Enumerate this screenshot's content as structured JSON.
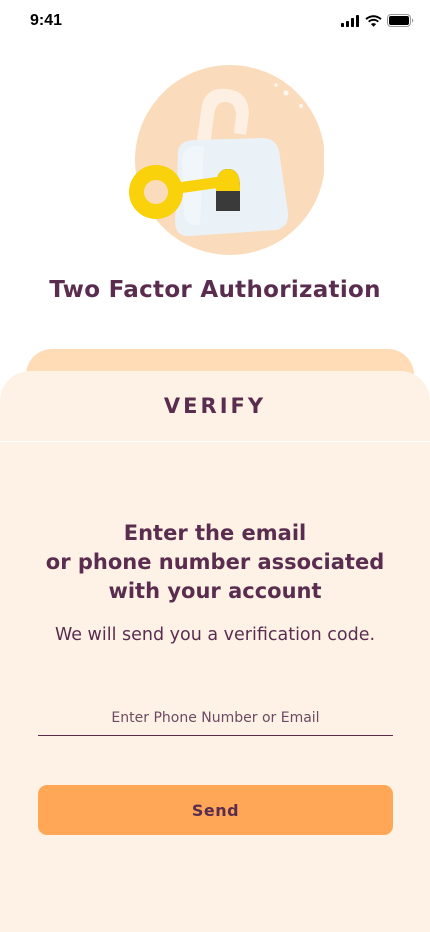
{
  "status_bar": {
    "time": "9:41"
  },
  "header": {
    "title": "Two Factor Authorization"
  },
  "card": {
    "heading": "VERIFY",
    "prompt_lines": [
      "Enter the email",
      "or phone number associated",
      "with your account"
    ],
    "subtitle": "We will send you a  verification code.",
    "input_placeholder": "Enter Phone Number or Email",
    "input_value": "",
    "send_label": "Send"
  },
  "colors": {
    "primary_text": "#5a2d4f",
    "card_bg": "#fef2e6",
    "back_card": "#ffdcb6",
    "button": "#ffa756",
    "key": "#f9d20b"
  },
  "icons": {
    "hero": "padlock-with-key-illustration",
    "signal": "cellular-signal-icon",
    "wifi": "wifi-icon",
    "battery": "battery-icon"
  }
}
